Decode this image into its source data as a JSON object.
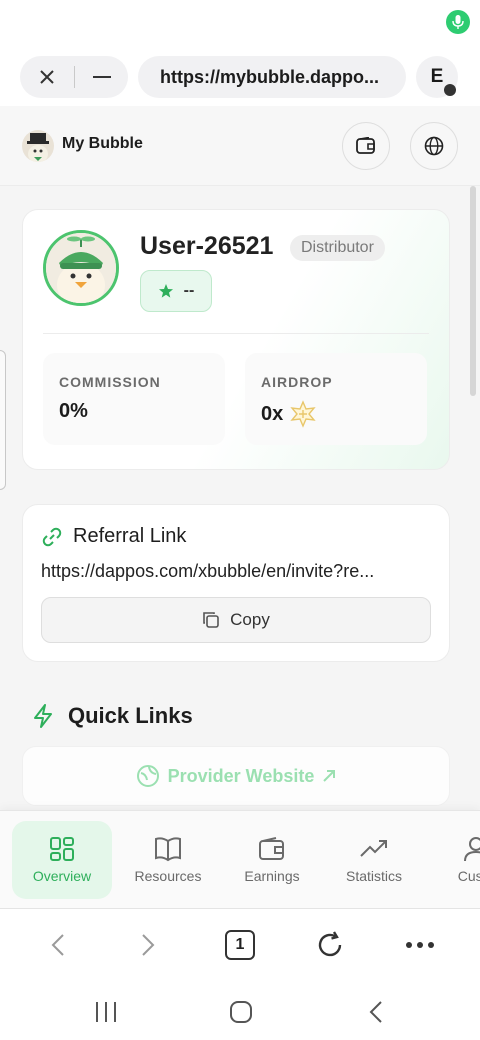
{
  "browser": {
    "url": "https://mybubble.dappo...",
    "extension_letter": "E",
    "tab_count": "1"
  },
  "site": {
    "title": "My Bubble"
  },
  "profile": {
    "username": "User-26521",
    "role": "Distributor",
    "level_value": "--",
    "commission_label": "COMMISSION",
    "commission_value": "0%",
    "airdrop_label": "AIRDROP",
    "airdrop_value": "0x"
  },
  "referral": {
    "title": "Referral Link",
    "url": "https://dappos.com/xbubble/en/invite?re...",
    "copy_label": "Copy"
  },
  "quick_links": {
    "title": "Quick Links",
    "provider_label": "Provider Website"
  },
  "tabs": [
    {
      "label": "Overview",
      "icon": "grid-icon",
      "active": true
    },
    {
      "label": "Resources",
      "icon": "book-icon",
      "active": false
    },
    {
      "label": "Earnings",
      "icon": "wallet-icon",
      "active": false
    },
    {
      "label": "Statistics",
      "icon": "trending-up-icon",
      "active": false
    },
    {
      "label": "Custo",
      "icon": "user-icon",
      "active": false
    }
  ],
  "colors": {
    "accent_green": "#2eaf5b",
    "light_green": "#e4f7ea",
    "mic_green": "#2ecc71"
  }
}
